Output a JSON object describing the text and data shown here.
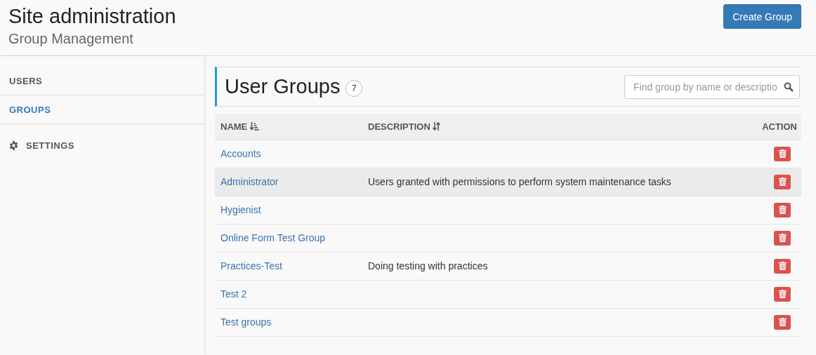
{
  "header": {
    "title": "Site administration",
    "subtitle": "Group Management",
    "create_button": "Create Group"
  },
  "sidebar": {
    "items": [
      {
        "label": "USERS",
        "kind": "text",
        "selected": false
      },
      {
        "label": "GROUPS",
        "kind": "text",
        "selected": true
      },
      {
        "label": "SETTINGS",
        "kind": "gear",
        "selected": false
      }
    ]
  },
  "panel": {
    "title": "User Groups",
    "count": "7",
    "search": {
      "placeholder": "Find group by name or descriptio"
    }
  },
  "table": {
    "columns": [
      {
        "label": "NAME",
        "kind": "sorted"
      },
      {
        "label": "DESCRIPTION",
        "kind": "sortable"
      },
      {
        "label": "ACTION",
        "kind": "plain"
      }
    ],
    "rows": [
      {
        "name": "Accounts",
        "highlighted": false
      },
      {
        "name": "Administrator",
        "description": "Users granted with permissions to perform system maintenance tasks",
        "highlighted": true
      },
      {
        "name": "Hygienist",
        "highlighted": false
      },
      {
        "name": "Online Form Test Group",
        "highlighted": false
      },
      {
        "name": "Practices-Test",
        "description": "Doing testing with practices",
        "highlighted": false
      },
      {
        "name": "Test 2",
        "highlighted": false
      },
      {
        "name": "Test groups",
        "highlighted": false
      }
    ]
  }
}
